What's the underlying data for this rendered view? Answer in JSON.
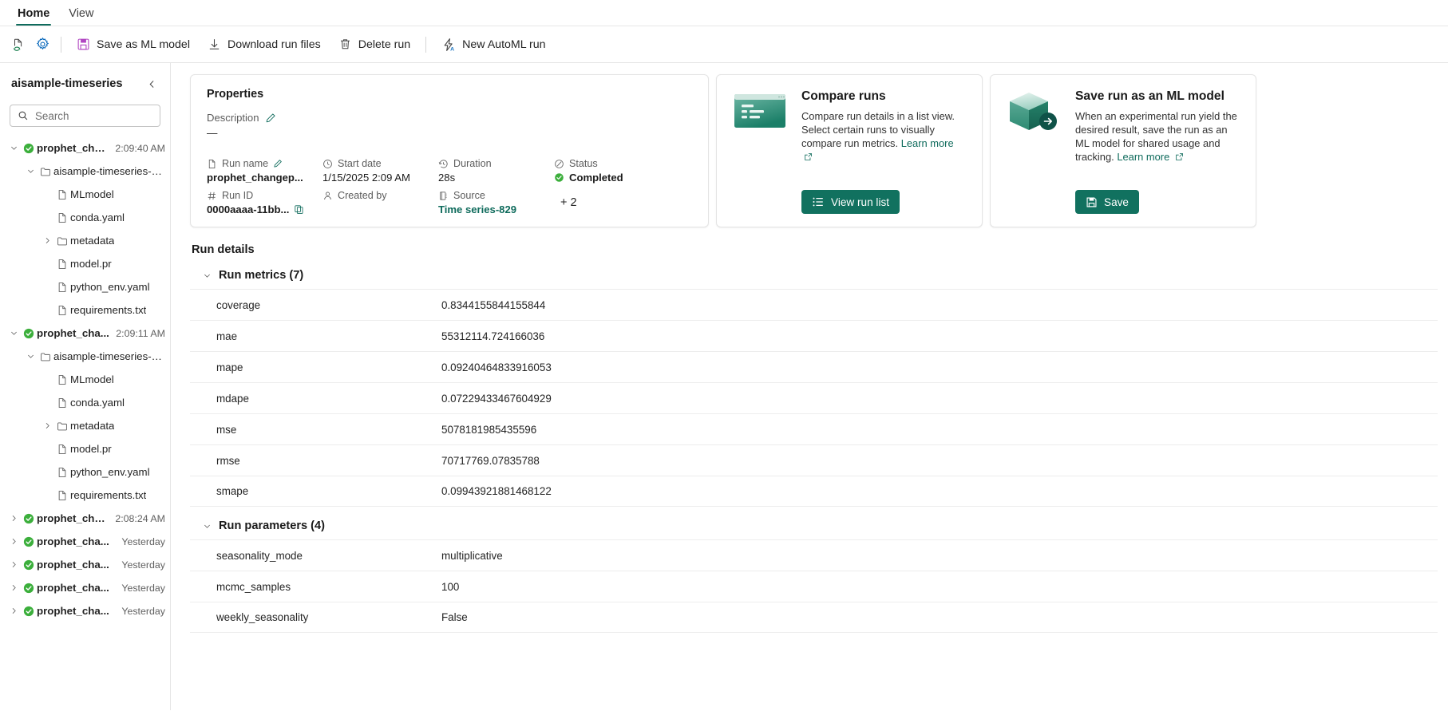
{
  "ribbon": {
    "tabs": [
      {
        "label": "Home",
        "active": true
      },
      {
        "label": "View",
        "active": false
      }
    ],
    "icon_buttons": [
      {
        "name": "refresh-page-icon"
      },
      {
        "name": "settings-gear-icon"
      }
    ],
    "commands": [
      {
        "label": "Save as ML model",
        "icon": "save-disk-icon"
      },
      {
        "label": "Download run files",
        "icon": "download-icon"
      },
      {
        "label": "Delete run",
        "icon": "trash-icon"
      },
      {
        "label": "New AutoML run",
        "icon": "automl-lightning-icon"
      }
    ]
  },
  "sidebar": {
    "title": "aisample-timeseries",
    "collapse_icon": "chevron-left-icon",
    "search": {
      "placeholder": "Search",
      "value": "",
      "icon": "search-icon"
    },
    "tree": [
      {
        "depth": 0,
        "chevron": "down",
        "icon": "status-success-icon",
        "label": "prophet_cha...",
        "bold": true,
        "time": "2:09:40 AM"
      },
      {
        "depth": 1,
        "chevron": "down",
        "icon": "folder-icon",
        "label": "aisample-timeseries-pr...",
        "bold": false,
        "time": ""
      },
      {
        "depth": 2,
        "chevron": "none",
        "icon": "file-icon",
        "label": "MLmodel",
        "bold": false,
        "time": ""
      },
      {
        "depth": 2,
        "chevron": "none",
        "icon": "file-icon",
        "label": "conda.yaml",
        "bold": false,
        "time": ""
      },
      {
        "depth": 2,
        "chevron": "right",
        "icon": "folder-icon",
        "label": "metadata",
        "bold": false,
        "time": ""
      },
      {
        "depth": 2,
        "chevron": "none",
        "icon": "file-icon",
        "label": "model.pr",
        "bold": false,
        "time": ""
      },
      {
        "depth": 2,
        "chevron": "none",
        "icon": "file-icon",
        "label": "python_env.yaml",
        "bold": false,
        "time": ""
      },
      {
        "depth": 2,
        "chevron": "none",
        "icon": "file-icon",
        "label": "requirements.txt",
        "bold": false,
        "time": ""
      },
      {
        "depth": 0,
        "chevron": "down",
        "icon": "status-success-icon",
        "label": "prophet_cha...",
        "bold": true,
        "time": "2:09:11 AM"
      },
      {
        "depth": 1,
        "chevron": "down",
        "icon": "folder-icon",
        "label": "aisample-timeseries-pr...",
        "bold": false,
        "time": ""
      },
      {
        "depth": 2,
        "chevron": "none",
        "icon": "file-icon",
        "label": "MLmodel",
        "bold": false,
        "time": ""
      },
      {
        "depth": 2,
        "chevron": "none",
        "icon": "file-icon",
        "label": "conda.yaml",
        "bold": false,
        "time": ""
      },
      {
        "depth": 2,
        "chevron": "right",
        "icon": "folder-icon",
        "label": "metadata",
        "bold": false,
        "time": ""
      },
      {
        "depth": 2,
        "chevron": "none",
        "icon": "file-icon",
        "label": "model.pr",
        "bold": false,
        "time": ""
      },
      {
        "depth": 2,
        "chevron": "none",
        "icon": "file-icon",
        "label": "python_env.yaml",
        "bold": false,
        "time": ""
      },
      {
        "depth": 2,
        "chevron": "none",
        "icon": "file-icon",
        "label": "requirements.txt",
        "bold": false,
        "time": ""
      },
      {
        "depth": 0,
        "chevron": "right",
        "icon": "status-success-icon",
        "label": "prophet_cha...",
        "bold": true,
        "time": "2:08:24 AM"
      },
      {
        "depth": 0,
        "chevron": "right",
        "icon": "status-success-icon",
        "label": "prophet_cha...",
        "bold": true,
        "time": "Yesterday"
      },
      {
        "depth": 0,
        "chevron": "right",
        "icon": "status-success-icon",
        "label": "prophet_cha...",
        "bold": true,
        "time": "Yesterday"
      },
      {
        "depth": 0,
        "chevron": "right",
        "icon": "status-success-icon",
        "label": "prophet_cha...",
        "bold": true,
        "time": "Yesterday"
      },
      {
        "depth": 0,
        "chevron": "right",
        "icon": "status-success-icon",
        "label": "prophet_cha...",
        "bold": true,
        "time": "Yesterday"
      }
    ]
  },
  "properties": {
    "title": "Properties",
    "description_label": "Description",
    "description_edit_icon": "pencil-edit-icon",
    "description_value": "—",
    "fields": [
      {
        "label": "Run name",
        "value": "prophet_changep...",
        "icon": "file-icon",
        "edit_icon": "pencil-edit-icon",
        "type": "bold"
      },
      {
        "label": "Start date",
        "value": "1/15/2025 2:09 AM",
        "icon": "clock-icon",
        "type": "normal"
      },
      {
        "label": "Duration",
        "value": "28s",
        "icon": "duration-history-icon",
        "type": "normal"
      },
      {
        "label": "Status",
        "value": "Completed",
        "icon": "status-ring-icon",
        "type": "status"
      },
      {
        "label": "Run ID",
        "value": "0000aaaa-11bb...",
        "icon": "hash-icon",
        "copy_icon": "copy-icon",
        "type": "bold"
      },
      {
        "label": "Created by",
        "value": "",
        "icon": "person-icon",
        "type": "normal"
      },
      {
        "label": "Source",
        "value": "Time series-829",
        "icon": "notebook-icon",
        "type": "link"
      }
    ],
    "more_count": "+ 2"
  },
  "compare_card": {
    "title": "Compare runs",
    "body_1": "Compare run details in a list view. Select",
    "body_2": "certain runs to visually compare run",
    "body_3": "metrics.",
    "learn_more": "Learn more",
    "external_icon": "open-external-icon",
    "art_icon": "compare-list-art-icon",
    "button_label": "View run list",
    "button_icon": "list-icon"
  },
  "save_card": {
    "title": "Save run as an ML model",
    "body_1": "When an experimental run yield the",
    "body_2": "desired result, save the run as an ML",
    "body_3": "model for shared usage and tracking.",
    "learn_more": "Learn more",
    "external_icon": "open-external-icon",
    "art_icon": "cube-arrow-art-icon",
    "button_label": "Save",
    "button_icon": "save-disk-icon"
  },
  "run_details": {
    "heading": "Run details",
    "sections": [
      {
        "title": "Run metrics (7)",
        "expanded": true,
        "rows": [
          {
            "key": "coverage",
            "value": "0.8344155844155844"
          },
          {
            "key": "mae",
            "value": "55312114.724166036"
          },
          {
            "key": "mape",
            "value": "0.09240464833916053"
          },
          {
            "key": "mdape",
            "value": "0.07229433467604929"
          },
          {
            "key": "mse",
            "value": "5078181985435596"
          },
          {
            "key": "rmse",
            "value": "70717769.07835788"
          },
          {
            "key": "smape",
            "value": "0.09943921881468122"
          }
        ]
      },
      {
        "title": "Run parameters (4)",
        "expanded": true,
        "rows": [
          {
            "key": "seasonality_mode",
            "value": "multiplicative"
          },
          {
            "key": "mcmc_samples",
            "value": "100"
          },
          {
            "key": "weekly_seasonality",
            "value": "False"
          }
        ]
      }
    ]
  },
  "colors": {
    "accent": "#11715f",
    "link": "#0f6b5c",
    "success": "#3caf3c",
    "magenta": "#b146c2",
    "blue": "#0f6cbd"
  }
}
